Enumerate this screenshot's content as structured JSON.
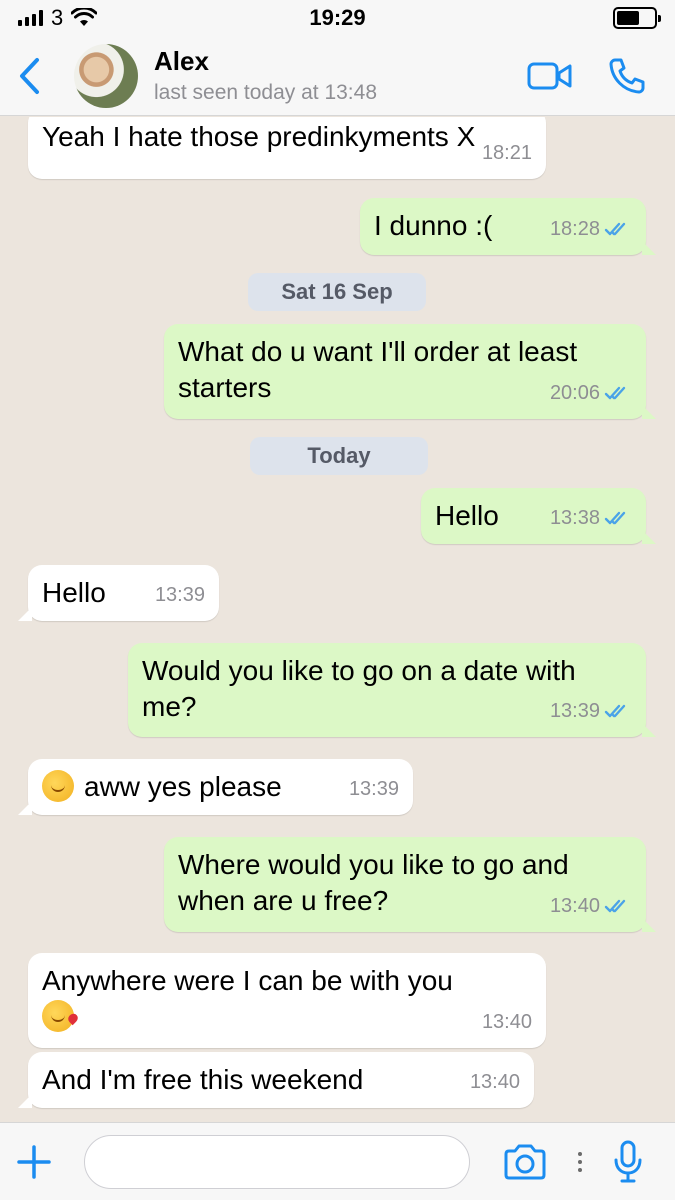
{
  "status_bar": {
    "carrier": "3",
    "time": "19:29"
  },
  "header": {
    "contact_name": "Alex",
    "last_seen": "last seen today at 13:48",
    "icons": [
      "back-chevron-icon",
      "video-call-icon",
      "phone-call-icon"
    ]
  },
  "colors": {
    "accent": "#1b8cf0",
    "incoming_bubble": "#ffffff",
    "outgoing_bubble": "#dcf8c6",
    "chat_background": "#ece5dd",
    "read_ticks": "#4aa3e8"
  },
  "chat": {
    "messages": [
      {
        "text": "Yeah I hate those predinkyments X",
        "time": "18:21",
        "direction": "in"
      },
      {
        "text": "I dunno :(",
        "time": "18:28",
        "direction": "out"
      },
      {
        "text": "What do u want I'll order at least starters",
        "time": "20:06",
        "direction": "out"
      },
      {
        "text": "Hello",
        "time": "13:38",
        "direction": "out"
      },
      {
        "text": "Hello",
        "time": "13:39",
        "direction": "in"
      },
      {
        "text": "Would you like to go on a date with me?",
        "time": "13:39",
        "direction": "out"
      },
      {
        "text": "aww yes please",
        "time": "13:39",
        "direction": "in",
        "emoji": "kissing-closed-eyes-emoji"
      },
      {
        "text": "Where would you like to go and when are u free?",
        "time": "13:40",
        "direction": "out"
      },
      {
        "text": "Anywhere were I can be with you",
        "time": "13:40",
        "direction": "in",
        "emoji": "face-blowing-kiss-emoji"
      },
      {
        "text": "And I'm free this weekend",
        "time": "13:40",
        "direction": "in"
      }
    ],
    "dates": [
      "Sat 16 Sep",
      "Today"
    ]
  },
  "input_bar": {
    "placeholder": "",
    "icons": [
      "plus-icon",
      "camera-icon",
      "more-dots-icon",
      "microphone-icon"
    ]
  }
}
